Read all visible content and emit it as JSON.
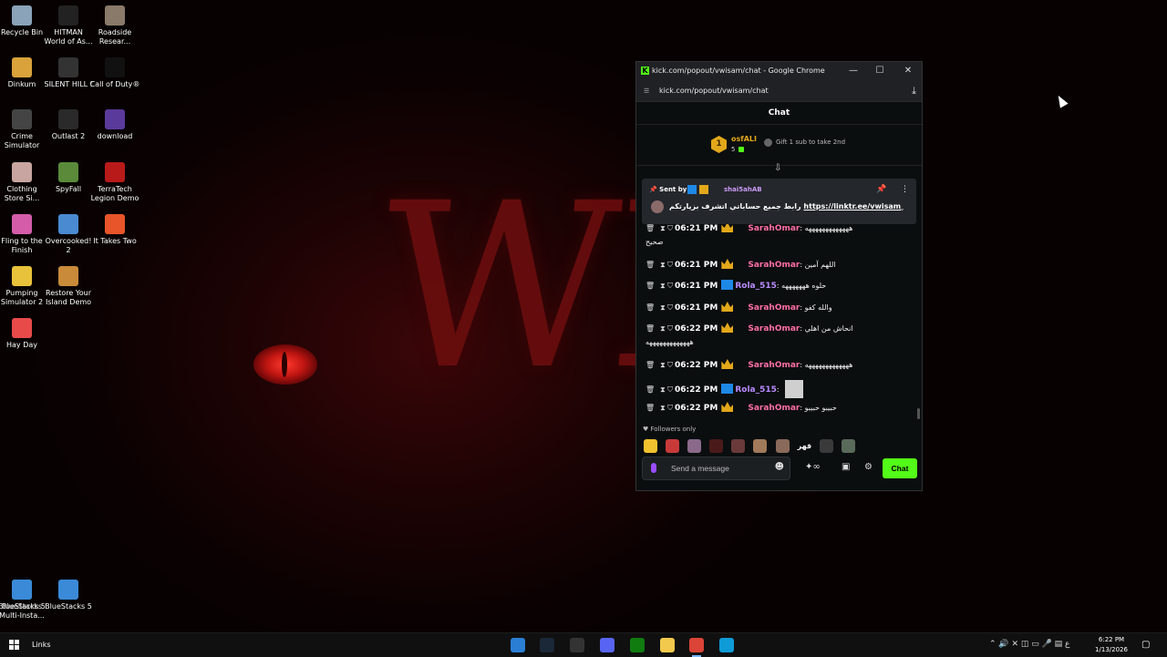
{
  "desktop": {
    "icons_col1": [
      {
        "label": "Recycle Bin",
        "color": "#8aa3b8"
      },
      {
        "label": "Dinkum",
        "color": "#d9a23a"
      },
      {
        "label": "Crime Simulator",
        "color": "#444444"
      },
      {
        "label": "Clothing Store Si...",
        "color": "#c8a5a0"
      },
      {
        "label": "Fling to the Finish",
        "color": "#d45ca8"
      },
      {
        "label": "Pumping Simulator 2",
        "color": "#e8c23a"
      },
      {
        "label": "Hay Day",
        "color": "#e84a4a"
      }
    ],
    "icons_col2": [
      {
        "label": "HITMAN World of As...",
        "color": "#222222"
      },
      {
        "label": "SILENT HILL f",
        "color": "#333333"
      },
      {
        "label": "Outlast 2",
        "color": "#2a2a2a"
      },
      {
        "label": "SpyFall",
        "color": "#5a8a3a"
      },
      {
        "label": "Overcooked! 2",
        "color": "#4a8ad0"
      },
      {
        "label": "Restore Your Island Demo",
        "color": "#c98a3a"
      }
    ],
    "icons_col3": [
      {
        "label": "Roadside Resear...",
        "color": "#8a7a6a"
      },
      {
        "label": "Call of Duty®",
        "color": "#111111"
      },
      {
        "label": "download",
        "color": "#5a3a9a"
      },
      {
        "label": "TerraTech Legion Demo",
        "color": "#b81a1a"
      },
      {
        "label": "It Takes Two",
        "color": "#e8552a"
      }
    ],
    "icons_bottom": [
      {
        "label": "BlueStacks Multi-Insta...",
        "color": "#5ac83a"
      },
      {
        "label": "BlueStacks 5",
        "color": "#3a8ad8"
      }
    ],
    "wallpaper_text": "WIS"
  },
  "browser": {
    "title": "kick.com/popout/vwisam/chat - Google Chrome",
    "logo": "K",
    "url": "kick.com/popout/vwisam/chat",
    "minimize": "—",
    "maximize": "☐",
    "close": "✕",
    "download_icon": "⤓",
    "site_info_icon": "☰"
  },
  "chat": {
    "header": "Chat",
    "leaderboard": {
      "rank": "1",
      "name": "osfALI",
      "count": "5",
      "gift_text": "Gift 1 sub to take 2nd"
    },
    "collapse_icon": "⇩",
    "pinned": {
      "sent_by": "📌 Sent by",
      "sender": "shai5ahAB",
      "message": "رابط جميع حساباتي اتشرف بزيارتكم",
      "link": "https://linktr.ee/vwisam",
      "pin_icon": "📌",
      "more_icon": "⋮",
      "expand_icon": "⌄"
    },
    "messages": [
      {
        "time": "06:21 PM",
        "user": "SarahOmar",
        "badge": "gold",
        "color": "pink",
        "text": ": هههههههههههههه"
      },
      {
        "time": "06:21 PM",
        "user": "SarahOmar",
        "badge": "gold",
        "color": "pink",
        "text": ": اللهم آمين"
      },
      {
        "time": "06:21 PM",
        "user": "Rola_515",
        "badge": "blue",
        "color": "purple",
        "text": ": حلوه هههههههه"
      },
      {
        "time": "06:21 PM",
        "user": "SarahOmar",
        "badge": "gold",
        "color": "pink",
        "text": ": والله كفو"
      },
      {
        "time": "06:22 PM",
        "user": "SarahOmar",
        "badge": "gold",
        "color": "pink",
        "text": ": انحاش من اهلي"
      },
      {
        "time": "06:22 PM",
        "user": "SarahOmar",
        "badge": "gold",
        "color": "pink",
        "text": ": هههههههههههههه"
      },
      {
        "time": "06:22 PM",
        "user": "Rola_515",
        "badge": "blue",
        "color": "purple",
        "text": ":"
      },
      {
        "time": "06:22 PM",
        "user": "SarahOmar",
        "badge": "gold",
        "color": "pink",
        "text": ": حبيبو حبيبو"
      }
    ],
    "continuation_1": "صحيح",
    "continuation_2": "هههههههههههههه",
    "mod_icons": {
      "trash": "🗑",
      "timeout": "⧗",
      "shield": "⛉"
    },
    "followers_only": "♥ Followers only",
    "emote_text": "قهر",
    "input_placeholder": "Send a message",
    "emoji_icon": "☻",
    "tool_icons": {
      "kicks": "✦∞",
      "store": "▣",
      "settings": "⚙"
    },
    "send_button": "Chat"
  },
  "taskbar": {
    "links_label": "Links",
    "apps": [
      {
        "name": "outlook",
        "color": "#2a7fd4"
      },
      {
        "name": "steam",
        "color": "#1b2838"
      },
      {
        "name": "obs",
        "color": "#333333"
      },
      {
        "name": "discord",
        "color": "#5865f2"
      },
      {
        "name": "xbox",
        "color": "#107c10"
      },
      {
        "name": "file-explorer",
        "color": "#f2c94c"
      },
      {
        "name": "chrome",
        "color": "#db4437"
      },
      {
        "name": "edge",
        "color": "#0f9bd7"
      }
    ],
    "tray_icons": "⌃  🔊  ✕  ◫  ▭  🎤  ▤  ع",
    "time": "6:22 PM",
    "date": "1/13/2026",
    "notification_icon": "▢"
  },
  "colors": {
    "kick_green": "#53fc18",
    "gold": "#e3a81a",
    "pink_user": "#ff6fa6",
    "purple_user": "#b98bff"
  }
}
